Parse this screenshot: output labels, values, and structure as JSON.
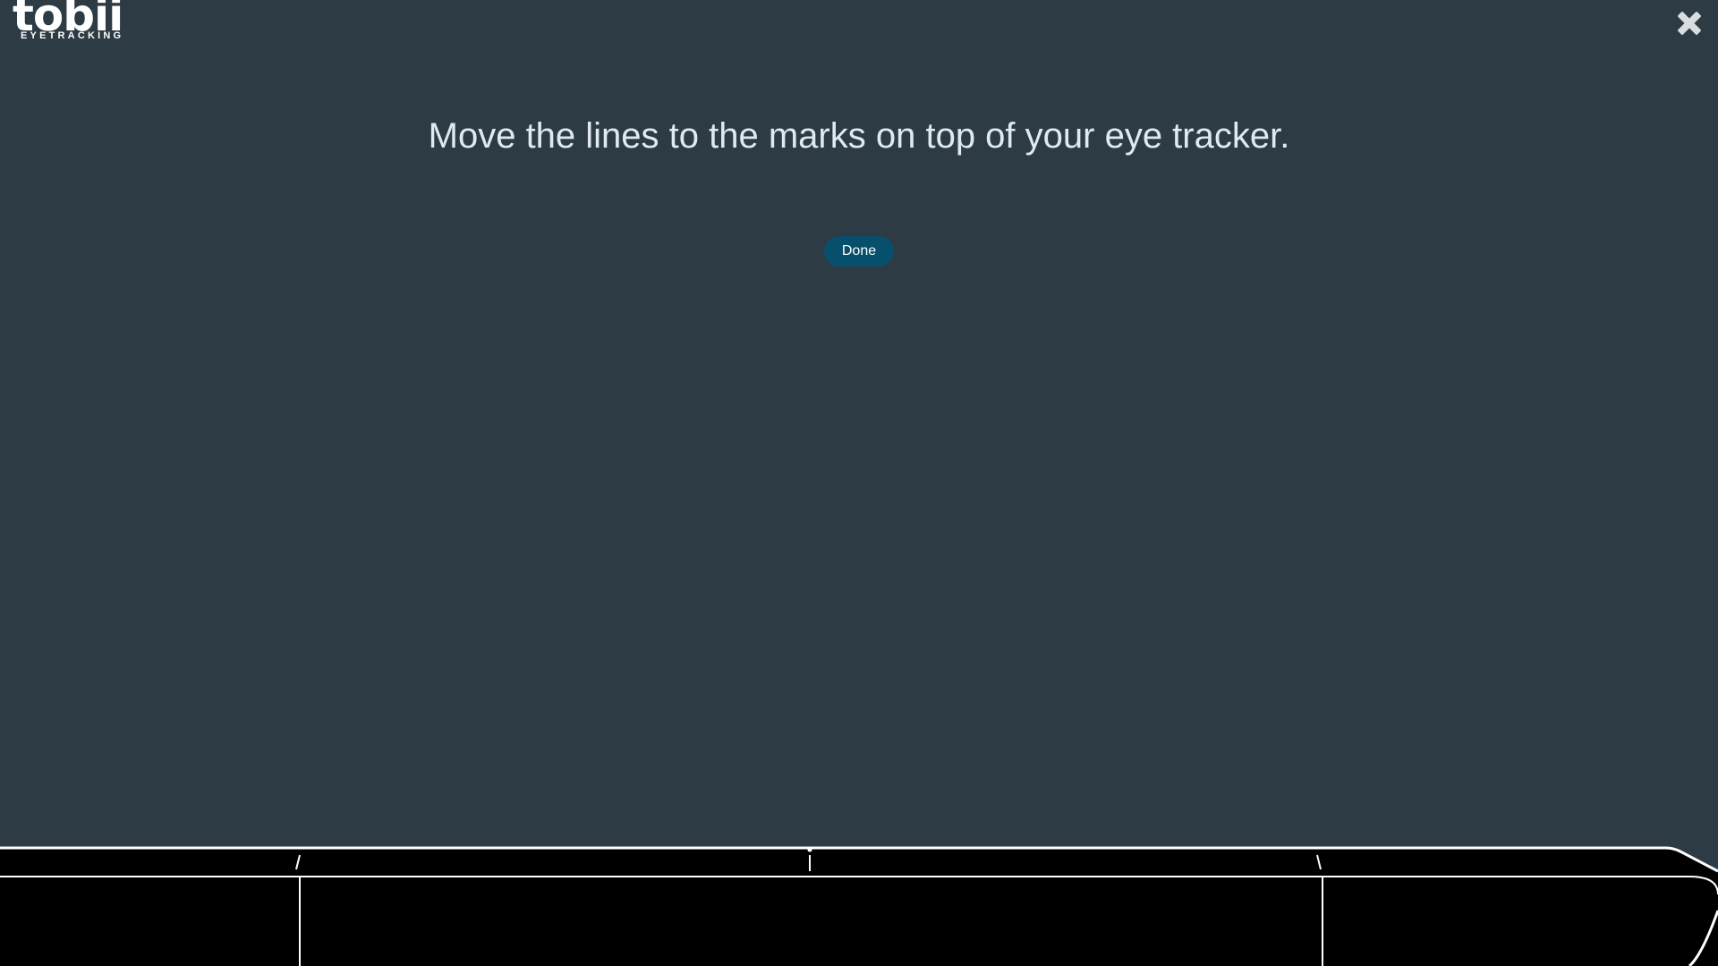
{
  "logo": {
    "word": "tobii",
    "tagline": "EYETRACKING"
  },
  "instruction": {
    "text": "Move the lines to the marks on top of your eye tracker."
  },
  "actions": {
    "done_label": "Done"
  },
  "icons": {
    "close": "close-icon"
  },
  "colors": {
    "background": "#2d3b45",
    "done_button": "#06506e",
    "tracker_body": "#000000",
    "tracker_outline": "#ffffff",
    "instruction_text": "#dfe9ef"
  }
}
